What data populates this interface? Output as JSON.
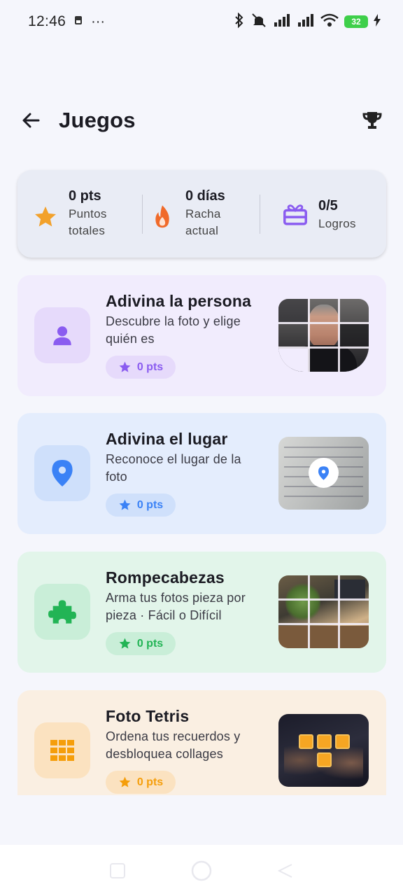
{
  "status_bar": {
    "time": "12:46",
    "more": "···",
    "battery": "32"
  },
  "header": {
    "title": "Juegos"
  },
  "stats": {
    "points": {
      "value": "0 pts",
      "label_line1": "Puntos",
      "label_line2": "totales",
      "icon": "star-icon",
      "color": "#f2a12b"
    },
    "streak": {
      "value": "0 días",
      "label_line1": "Racha",
      "label_line2": "actual",
      "icon": "fire-icon",
      "color": "#f06a2a"
    },
    "achievements": {
      "value": "0/5",
      "label": "Logros",
      "icon": "gift-icon",
      "color": "#8a5cf0"
    }
  },
  "games": [
    {
      "title": "Adivina la persona",
      "description": "Descubre la foto y elige quién es",
      "points": "0 pts",
      "icon": "person-icon",
      "card_bg": "#f1ecfd",
      "icon_bg": "#e6dafb",
      "accent": "#8a5cf0",
      "badge_bg": "#e6dafb"
    },
    {
      "title": "Adivina el lugar",
      "description": "Reconoce el lugar de la foto",
      "points": "0 pts",
      "icon": "location-pin-icon",
      "card_bg": "#e4edfd",
      "icon_bg": "#cfe0fb",
      "accent": "#3b82f6",
      "badge_bg": "#cfe0fb"
    },
    {
      "title": "Rompecabezas",
      "description": "Arma tus fotos pieza por pieza · Fácil o Difícil",
      "points": "0 pts",
      "icon": "puzzle-icon",
      "card_bg": "#e2f5ea",
      "icon_bg": "#c9eed8",
      "accent": "#22b455",
      "badge_bg": "#c9eed8"
    },
    {
      "title": "Foto Tetris",
      "description": "Ordena tus recuerdos y desbloquea collages",
      "points": "0 pts",
      "icon": "grid-icon",
      "card_bg": "#faefe2",
      "icon_bg": "#fbe2c0",
      "accent": "#f59e0b",
      "badge_bg": "#fbe2c0"
    }
  ]
}
